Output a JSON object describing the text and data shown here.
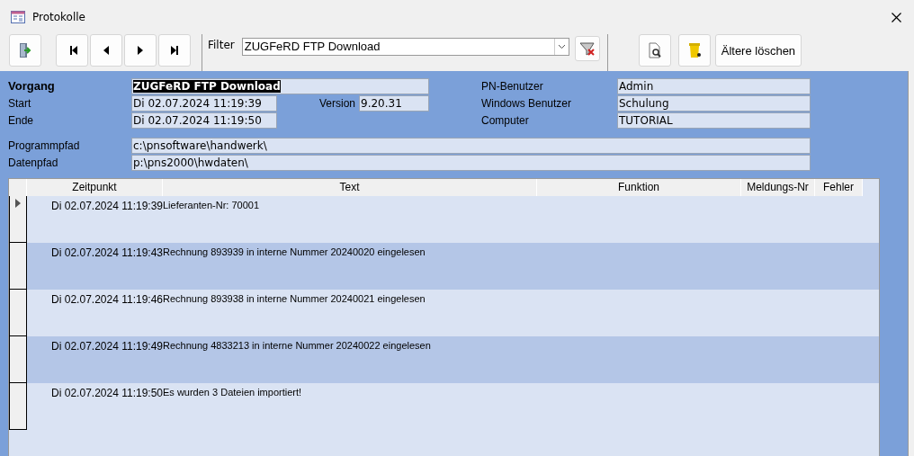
{
  "window": {
    "title": "Protokolle"
  },
  "toolbar": {
    "nav_buttons": [
      {
        "kind": "first"
      },
      {
        "kind": "prev"
      },
      {
        "kind": "next"
      },
      {
        "kind": "last"
      }
    ],
    "filter": {
      "label": "Filter",
      "value": "ZUGFeRD FTP Download"
    },
    "delete_button": "Ältere löschen"
  },
  "form": {
    "vorgang": {
      "label": "Vorgang",
      "value": "ZUGFeRD FTP Download",
      "text_selected": true
    },
    "start": {
      "label": "Start",
      "value": "Di 02.07.2024 11:19:39"
    },
    "ende": {
      "label": "Ende",
      "value": "Di 02.07.2024 11:19:50"
    },
    "version": {
      "label": "Version",
      "value": "9.20.31"
    },
    "pn_benutzer": {
      "label": "PN-Benutzer",
      "value": "Admin"
    },
    "windows_benutzer": {
      "label": "Windows Benutzer",
      "value": "Schulung"
    },
    "computer": {
      "label": "Computer",
      "value": "TUTORIAL"
    },
    "programmpfad": {
      "label": "Programmpfad",
      "value": "c:\\pnsoftware\\handwerk\\"
    },
    "datenpfad": {
      "label": "Datenpfad",
      "value": "p:\\pns2000\\hwdaten\\"
    }
  },
  "table": {
    "columns": [
      "Zeitpunkt",
      "Text",
      "Funktion",
      "Meldungs-Nr",
      "Fehler"
    ],
    "rows": [
      {
        "zeitpunkt": "Di 02.07.2024 11:19:39",
        "text": "Lieferanten-Nr: 70001",
        "current": true
      },
      {
        "zeitpunkt": "Di 02.07.2024 11:19:43",
        "text": "Rechnung 893939 in interne Nummer 20240020 eingelesen",
        "current": false
      },
      {
        "zeitpunkt": "Di 02.07.2024 11:19:46",
        "text": "Rechnung 893938 in interne Nummer 20240021 eingelesen",
        "current": false
      },
      {
        "zeitpunkt": "Di 02.07.2024 11:19:49",
        "text": "Rechnung 4833213 in interne Nummer 20240022 eingelesen",
        "current": false
      },
      {
        "zeitpunkt": "Di 02.07.2024 11:19:50",
        "text": "Es wurden 3 Dateien importiert!",
        "current": false
      }
    ]
  }
}
